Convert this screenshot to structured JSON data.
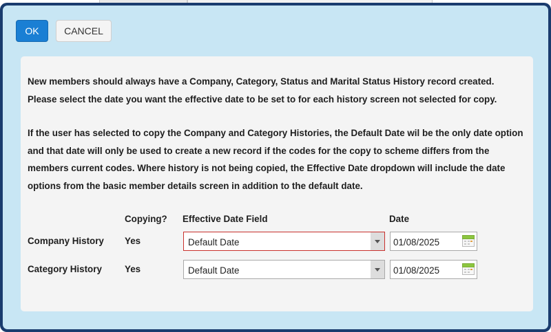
{
  "toolbar": {
    "ok_label": "OK",
    "cancel_label": "CANCEL"
  },
  "intro": {
    "paragraph1": "New members should always have a Company, Category, Status and Marital Status History record created. Please select the date you want the effective date to be set to for each history screen not selected for copy.",
    "paragraph2": "If the user has selected to copy the Company and Category Histories, the Default Date wil be the only date option and that date will only be used to create a new record if the codes for the copy to scheme differs from the members current codes. Where history is not being copied, the Effective Date dropdown will include the date options from the basic member details screen in addition to the default date."
  },
  "table": {
    "headers": {
      "copying": "Copying?",
      "effective_date_field": "Effective Date Field",
      "date": "Date"
    },
    "rows": [
      {
        "label": "Company History",
        "copying": "Yes",
        "effective_date_field": "Default Date",
        "date": "01/08/2025",
        "invalid": true
      },
      {
        "label": "Category History",
        "copying": "Yes",
        "effective_date_field": "Default Date",
        "date": "01/08/2025",
        "invalid": false
      }
    ]
  },
  "icons": {
    "calendar": "calendar-icon",
    "dropdown": "chevron-down-icon"
  },
  "colors": {
    "dialog_border": "#1a3c6e",
    "dialog_bg": "#c8e6f4",
    "ok_button": "#1a7fd4",
    "error_border": "#c9302c",
    "calendar_green": "#8cc63f"
  }
}
